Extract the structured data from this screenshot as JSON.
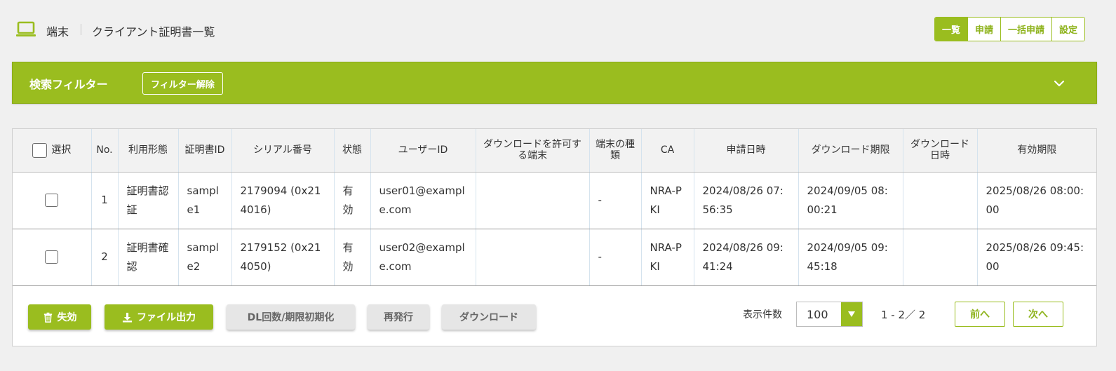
{
  "header": {
    "breadcrumb_root": "端末",
    "page_title": "クライアント証明書一覧",
    "tabs": [
      {
        "label": "一覧",
        "active": true
      },
      {
        "label": "申請",
        "active": false
      },
      {
        "label": "一括申請",
        "active": false
      },
      {
        "label": "設定",
        "active": false
      }
    ]
  },
  "filter": {
    "title": "検索フィルター",
    "clear_label": "フィルター解除",
    "toggle_icon": "chevron-down-icon"
  },
  "table": {
    "columns": [
      "選択",
      "No.",
      "利用形態",
      "証明書ID",
      "シリアル番号",
      "状態",
      "ユーザーID",
      "ダウンロードを許可する端末",
      "端末の種類",
      "CA",
      "申請日時",
      "ダウンロード期限",
      "ダウンロード日時",
      "有効期限"
    ],
    "rows": [
      {
        "no": "1",
        "usage": "証明書認証",
        "cert_id": "sample1",
        "serial": "2179094 (0x214016)",
        "status": "有効",
        "user_id": "user01@example.com",
        "allowed_device": "",
        "device_type": "-",
        "ca": "NRA-PKI",
        "applied_at": "2024/08/26 07:56:35",
        "download_deadline": "2024/09/05 08:00:21",
        "downloaded_at": "",
        "valid_until": "2025/08/26 08:00:00",
        "selected": false
      },
      {
        "no": "2",
        "usage": "証明書確認",
        "cert_id": "sample2",
        "serial": "2179152 (0x214050)",
        "status": "有効",
        "user_id": "user02@example.com",
        "allowed_device": "",
        "device_type": "-",
        "ca": "NRA-PKI",
        "applied_at": "2024/08/26 09:41:24",
        "download_deadline": "2024/09/05 09:45:18",
        "downloaded_at": "",
        "valid_until": "2025/08/26 09:45:00",
        "selected": false
      }
    ]
  },
  "actions": {
    "revoke_label": "失効",
    "export_label": "ファイル出力",
    "reset_label": "DL回数/期限初期化",
    "reissue_label": "再発行",
    "download_label": "ダウンロード"
  },
  "pagination": {
    "per_page_label": "表示件数",
    "per_page_value": "100",
    "range_text": "1 - 2／ 2",
    "prev_label": "前へ",
    "next_label": "次へ"
  },
  "colors": {
    "accent": "#9abd1f",
    "accent_text": "#8eb31c",
    "gray_button": "#e6e6e6"
  }
}
